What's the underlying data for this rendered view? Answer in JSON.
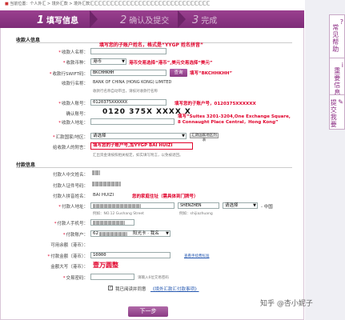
{
  "breadcrumb": "当前位置：个人外汇 > 境外汇款 > 境外汇款汇汇汇汇汇汇汇汇汇汇汇汇汇汇汇汇汇汇汇汇汇汇汇汇汇汇汇汇汇汇",
  "steps": [
    {
      "num": "1",
      "label": "填写信息"
    },
    {
      "num": "2",
      "label": "确认及提交"
    },
    {
      "num": "3",
      "label": "完成"
    }
  ],
  "payee": {
    "section": "收款人信息",
    "name_label": "收款人名称：",
    "name_note": "填写您的子账户姓名，格式是“YYGP 姓名拼音”",
    "currency_label": "收款币种：",
    "currency_value": "港币",
    "currency_note": "港币交易选择“港币”,美元交易选择“美元”",
    "swift_label": "收款行SWIFT码：",
    "swift_value": "BKCHHKHH",
    "swift_btn": "查询",
    "swift_note": "填写“BKCHHKHH”",
    "bank_name_label": "收款行名称：",
    "bank_name_value": "BANK OF CHINA (HONG KONG) LIMITED",
    "bank_hint": "收款行名称自动带出，请核对收款行名称",
    "account_label": "收款人账号：",
    "account_value": "0120375XXXXXX",
    "account_note": "填写您的子账户号，0120375XXXXXX",
    "confirm_label": "确认账号：",
    "confirm_value": "0120 375X XXXX X",
    "address_label": "收款人地址：",
    "address_note": "填写“Suites 3201-3204,One Exchange Square,\n8 Connaught Place Central，Hong Kong”",
    "region_label": "汇款国家/地区：",
    "region_value": "请选择",
    "region_link": "汇款国家地区列表",
    "message_label": "给收款人的附言：",
    "message_value": "填写您的子账户号,加YYGP BAI HUIZI",
    "message_hint": "汇出资金请按照相关规定，如实填写附言，以免被退回。"
  },
  "payer": {
    "section": "付款信息",
    "cn_name_label": "付款人中文姓名：",
    "id_label": "付款人证件号码：",
    "en_name_label": "付款人拼音姓名：",
    "en_name_value": "BAI HUIZI",
    "en_name_note": "您的家庭住址（需具体到门牌号）",
    "address_label": "付款人地址：",
    "city_value": "SHENZHEN",
    "prov_value": "请选择",
    "country_value": "中国",
    "address_hint": "例如：NO.12 Gushang Street",
    "city_hint": "例如：shijiazhuang",
    "phone_label": "付款人手机号：",
    "account_label": "付款账户：",
    "account_value": "62",
    "account_tag": "阳光卡 · 我名",
    "balance_label": "可用余额（港币）：",
    "amount_label": "付款金额（港币）：",
    "amount_value": "10000",
    "amount_link": "查看手续费标准",
    "amount_caps_label": "金额大写（港币）：",
    "amount_caps_value": "壹万圆整",
    "code_label": "交易密码：",
    "code_hint": "请输入6位交易密码",
    "agree_text": "我已阅读并同意",
    "agree_link": "《境外汇款汇付款事项》"
  },
  "next_button": "下一步",
  "sidebar": {
    "tabs": [
      "常见帮助",
      "重要信息",
      "提交我要"
    ]
  },
  "watermark": "知乎 @杏小妮子"
}
